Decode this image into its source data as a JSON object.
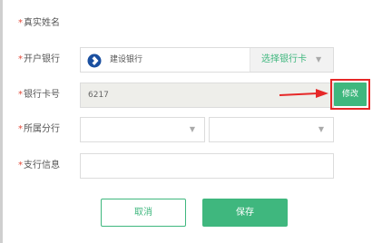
{
  "form": {
    "name": {
      "required": "*",
      "label": "真实姓名"
    },
    "bank": {
      "required": "*",
      "label": "开户银行",
      "bank_name": "建设银行",
      "select_label": "选择银行卡",
      "caret": "▼"
    },
    "card": {
      "required": "*",
      "label": "银行卡号",
      "value": "6217",
      "modify_label": "修改"
    },
    "branch": {
      "required": "*",
      "label": "所属分行",
      "caret": "▼"
    },
    "branch_info": {
      "required": "*",
      "label": "支行信息",
      "value": ""
    }
  },
  "actions": {
    "cancel_label": "取消",
    "save_label": "保存"
  },
  "colors": {
    "accent": "#3fb77e",
    "required": "#e34a3a",
    "highlight": "#e62828",
    "bank_logo": "#1a4fa0"
  }
}
